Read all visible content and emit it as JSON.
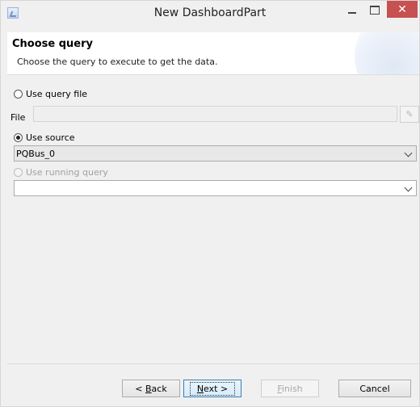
{
  "window": {
    "title": "New DashboardPart",
    "icon": "wizard-icon",
    "close_glyph": "✕"
  },
  "header": {
    "title": "Choose query",
    "description": "Choose the query to execute to get the data."
  },
  "options": {
    "use_query_file": {
      "label": "Use query file",
      "selected": false
    },
    "file": {
      "label": "File",
      "value": "",
      "enabled": false
    },
    "use_source": {
      "label": "Use source",
      "selected": true
    },
    "source_select": {
      "value": "PQBus_0"
    },
    "use_running_query": {
      "label": "Use running query",
      "selected": false,
      "enabled": false
    },
    "running_query_select": {
      "value": ""
    }
  },
  "buttons": {
    "back": {
      "prefix": "< ",
      "mnemonic": "B",
      "rest": "ack"
    },
    "next": {
      "mnemonic": "N",
      "rest": "ext >"
    },
    "finish": {
      "mnemonic": "F",
      "rest": "inish"
    },
    "cancel": {
      "label": "Cancel"
    }
  }
}
